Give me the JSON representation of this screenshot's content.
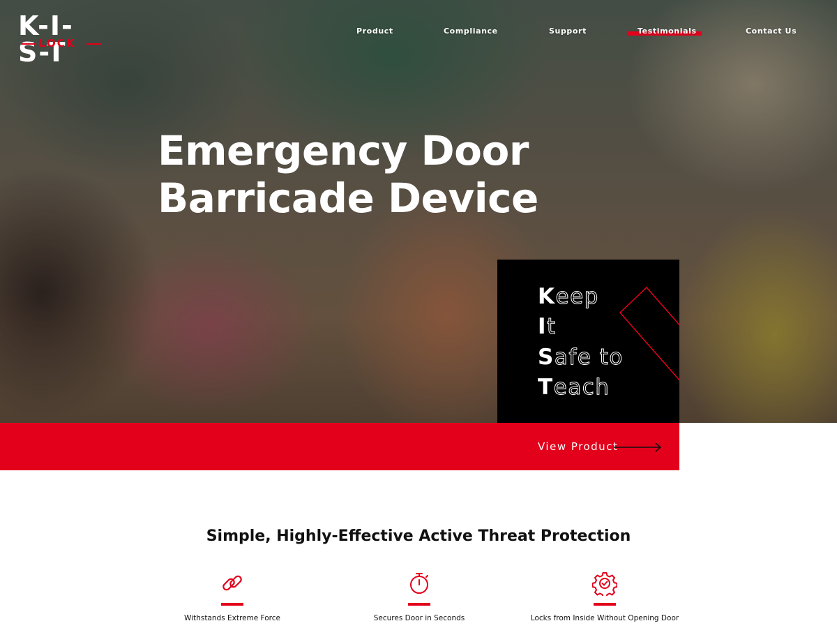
{
  "brand": {
    "logo_main": "K-I-S-T",
    "logo_sub": "LOCK",
    "accent": "#e3001b"
  },
  "nav": {
    "items": [
      {
        "label": "Product"
      },
      {
        "label": "Compliance"
      },
      {
        "label": "Support"
      },
      {
        "label": "Testimonials",
        "active": true
      },
      {
        "label": "Contact Us"
      }
    ]
  },
  "hero": {
    "title_line1": "Emergency Door",
    "title_line2": "Barricade Device",
    "motto": [
      {
        "initial": "K",
        "rest": "eep"
      },
      {
        "initial": "I",
        "rest": "t"
      },
      {
        "initial": "S",
        "rest": "afe to"
      },
      {
        "initial": "T",
        "rest": "each"
      }
    ],
    "cta_label": "View Product"
  },
  "features": {
    "title": "Simple, Highly-Effective Active Threat Protection",
    "items": [
      {
        "icon": "chain-link-icon",
        "label": "Withstands Extreme Force"
      },
      {
        "icon": "stopwatch-icon",
        "label": "Secures Door in Seconds"
      },
      {
        "icon": "gear-check-icon",
        "label": "Locks from Inside Without Opening Door"
      }
    ]
  }
}
